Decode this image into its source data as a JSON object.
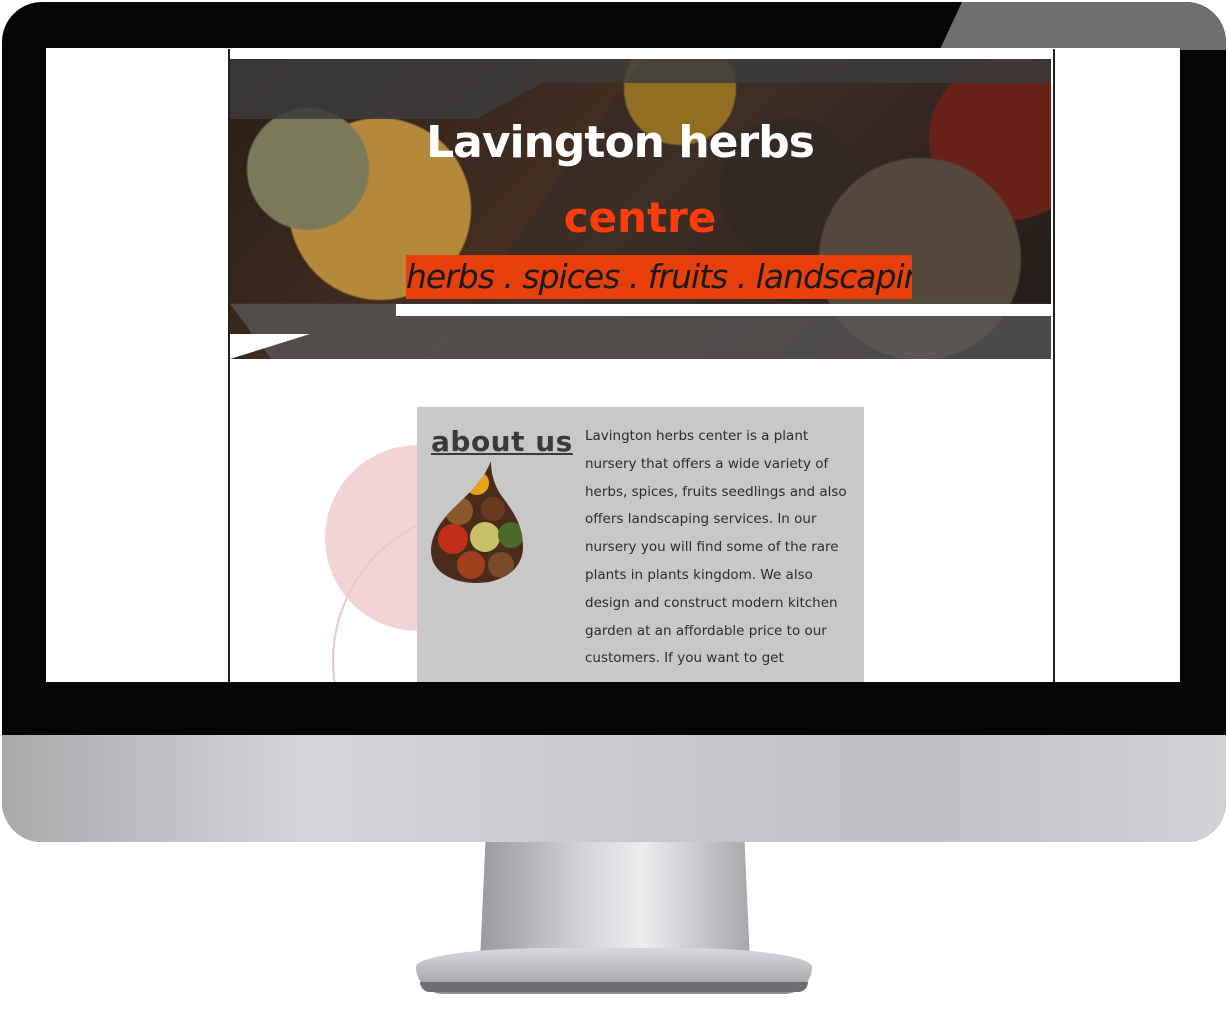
{
  "site": {
    "hero": {
      "title_line1": "Lavington herbs",
      "title_line2": "centre",
      "tagline": "herbs . spices . fruits . landscaping"
    },
    "about": {
      "heading": "about us",
      "text": "Lavington herbs center is a plant nursery that offers a wide variety of herbs, spices, fruits seedlings and also offers landscaping services. In our nursery you will find some of the rare plants in plants kingdom. We also design and construct modern kitchen garden at an affordable price to our customers. If you want to get"
    }
  },
  "colors": {
    "accent": "#ff3d0a",
    "tagline_bg": "#e8400c",
    "about_bg": "#c8c8c8",
    "bezel": "#050505"
  },
  "icons": {
    "about_image": "spice-bowls-drop-image"
  }
}
